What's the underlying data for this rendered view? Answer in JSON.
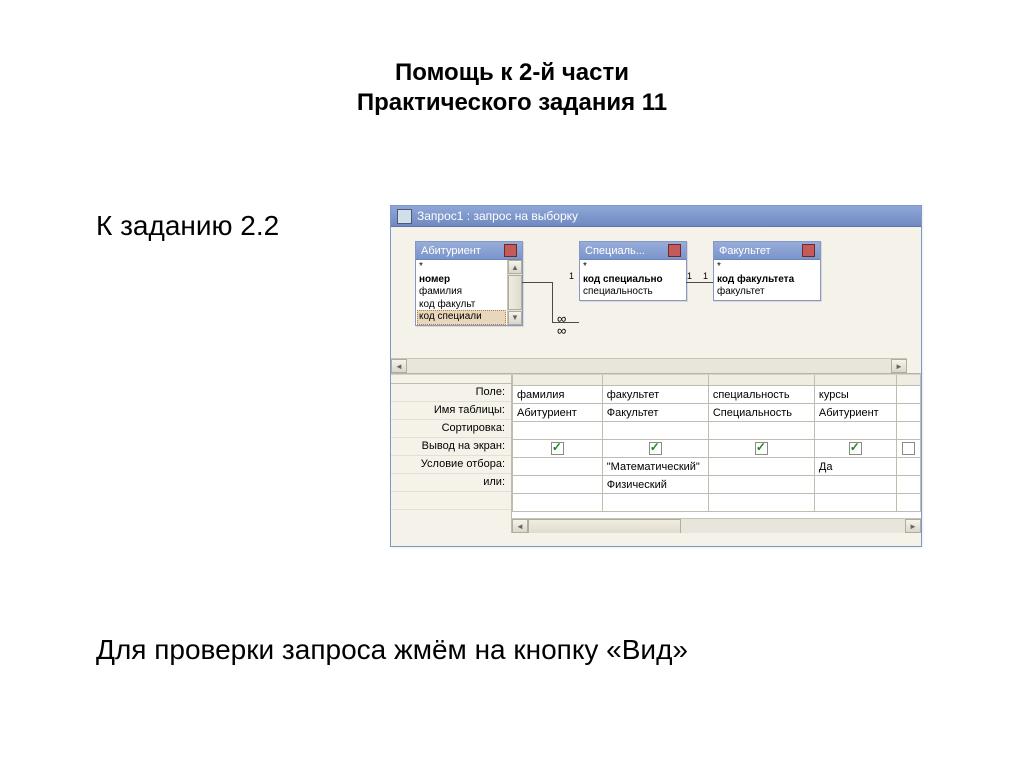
{
  "title_line1": "Помощь к 2-й части",
  "title_line2": "Практического задания 11",
  "subtitle": "К заданию 2.2",
  "bottom_text": "Для проверки запроса жмём на кнопку «Вид»",
  "window": {
    "title": "Запрос1 : запрос на выборку",
    "tables": {
      "t1": {
        "name": "Абитуриент",
        "fields": [
          "*",
          "номер",
          "фамилия",
          "код факульт",
          "код специали"
        ]
      },
      "t2": {
        "name": "Специаль...",
        "fields": [
          "*",
          "код специально",
          "специальность"
        ]
      },
      "t3": {
        "name": "Факультет",
        "fields": [
          "*",
          "код факультета",
          "факультет"
        ]
      }
    },
    "relations": {
      "left": {
        "one": "1",
        "many": "∞"
      },
      "right": {
        "one": "1",
        "many": "∞"
      }
    },
    "grid": {
      "row_labels": [
        "Поле:",
        "Имя таблицы:",
        "Сортировка:",
        "Вывод на экран:",
        "Условие отбора:",
        "или:"
      ],
      "cols": [
        {
          "field": "фамилия",
          "table": "Абитуриент",
          "show": true,
          "crit": "",
          "or": ""
        },
        {
          "field": "факультет",
          "table": "Факультет",
          "show": true,
          "crit": "\"Математический\"",
          "or": "Физический"
        },
        {
          "field": "специальность",
          "table": "Специальность",
          "show": true,
          "crit": "",
          "or": ""
        },
        {
          "field": "курсы",
          "table": "Абитуриент",
          "show": true,
          "crit": "Да",
          "or": ""
        }
      ]
    }
  }
}
